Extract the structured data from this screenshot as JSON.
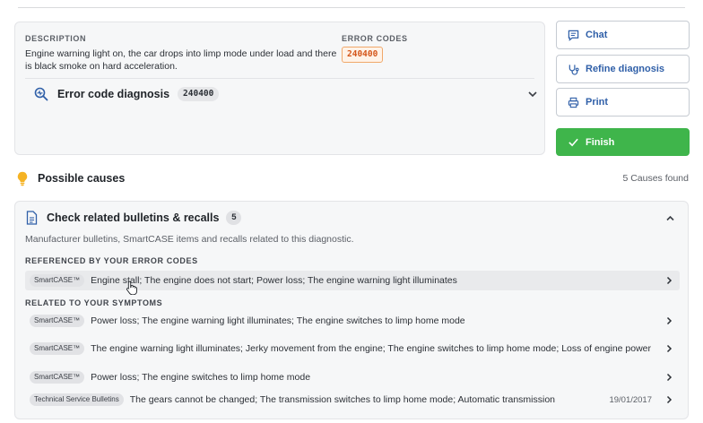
{
  "description": {
    "label": "DESCRIPTION",
    "text": "Engine warning light on, the car drops into limp mode under load and there is black smoke on hard acceleration."
  },
  "error_codes": {
    "label": "ERROR CODES",
    "code": "240400"
  },
  "diagnosis": {
    "title": "Error code diagnosis",
    "code": "240400"
  },
  "actions": {
    "chat": "Chat",
    "refine": "Refine diagnosis",
    "print": "Print",
    "finish": "Finish"
  },
  "causes": {
    "title": "Possible causes",
    "count": "5 Causes found"
  },
  "bulletins": {
    "title": "Check related bulletins & recalls",
    "count": "5",
    "subtitle": "Manufacturer bulletins, SmartCASE items and recalls related to this diagnostic.",
    "section_codes": "REFERENCED BY YOUR ERROR CODES",
    "section_symptoms": "RELATED TO YOUR SYMPTOMS",
    "items": [
      {
        "tag": "SmartCASE™",
        "text": "Engine stall; The engine does not start; Power loss; The engine warning light illuminates",
        "date": ""
      },
      {
        "tag": "SmartCASE™",
        "text": "Power loss; The engine warning light illuminates; The engine switches to limp home mode",
        "date": ""
      },
      {
        "tag": "SmartCASE™",
        "text": "The engine warning light illuminates; Jerky movement from the engine; The engine switches to limp home mode; Loss of engine power",
        "date": ""
      },
      {
        "tag": "SmartCASE™",
        "text": "Power loss; The engine switches to limp home mode",
        "date": ""
      },
      {
        "tag": "Technical Service Bulletins",
        "text": "The gears cannot be changed; The transmission switches to limp home mode; Automatic transmission",
        "date": "19/01/2017"
      }
    ]
  },
  "colors": {
    "accent_blue": "#2f5fa8",
    "finish_green": "#3fb54b",
    "error_code_orange": "#d4561a",
    "bulb_yellow": "#f5b324"
  }
}
